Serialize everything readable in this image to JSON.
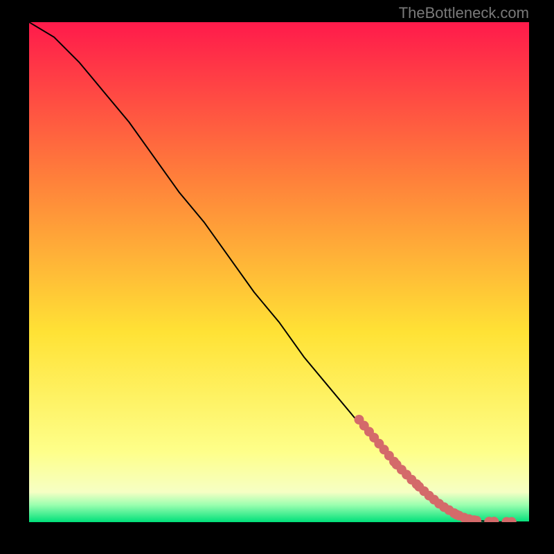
{
  "watermark": "TheBottleneck.com",
  "colors": {
    "gradient_top": "#ff1a4b",
    "gradient_mid1": "#ff823a",
    "gradient_mid2": "#ffe235",
    "gradient_mid3": "#feff8a",
    "gradient_green_light": "#9dffb0",
    "gradient_green": "#00e07a",
    "curve": "#000000",
    "marker": "#d46a6a",
    "frame": "#000000"
  },
  "chart_data": {
    "type": "line",
    "title": "",
    "xlabel": "",
    "ylabel": "",
    "xlim": [
      0,
      100
    ],
    "ylim": [
      0,
      100
    ],
    "curve": {
      "x": [
        0,
        5,
        10,
        15,
        20,
        25,
        30,
        35,
        40,
        45,
        50,
        55,
        60,
        65,
        70,
        75,
        80,
        82,
        85,
        88,
        90,
        92,
        95,
        100
      ],
      "y": [
        100,
        97,
        92,
        86,
        80,
        73,
        66,
        60,
        53,
        46,
        40,
        33,
        27,
        21,
        15,
        10,
        5,
        3,
        1.5,
        0.7,
        0.3,
        0.1,
        0,
        0
      ]
    },
    "markers": {
      "x": [
        66,
        67,
        68,
        69,
        70,
        71,
        72,
        73,
        73.5,
        74.5,
        75.5,
        76.5,
        77.5,
        78,
        79,
        80,
        81,
        82,
        83,
        84,
        85,
        85.5,
        86,
        87,
        88,
        89,
        89.5,
        92,
        93,
        95.5,
        96.5
      ],
      "y": [
        20.5,
        19.3,
        18.1,
        16.9,
        15.7,
        14.5,
        13.3,
        12.1,
        11.5,
        10.5,
        9.5,
        8.5,
        7.6,
        7.1,
        6.2,
        5.3,
        4.5,
        3.7,
        3.0,
        2.4,
        1.8,
        1.5,
        1.3,
        0.9,
        0.6,
        0.4,
        0.3,
        0.1,
        0.1,
        0.05,
        0.05
      ]
    }
  }
}
